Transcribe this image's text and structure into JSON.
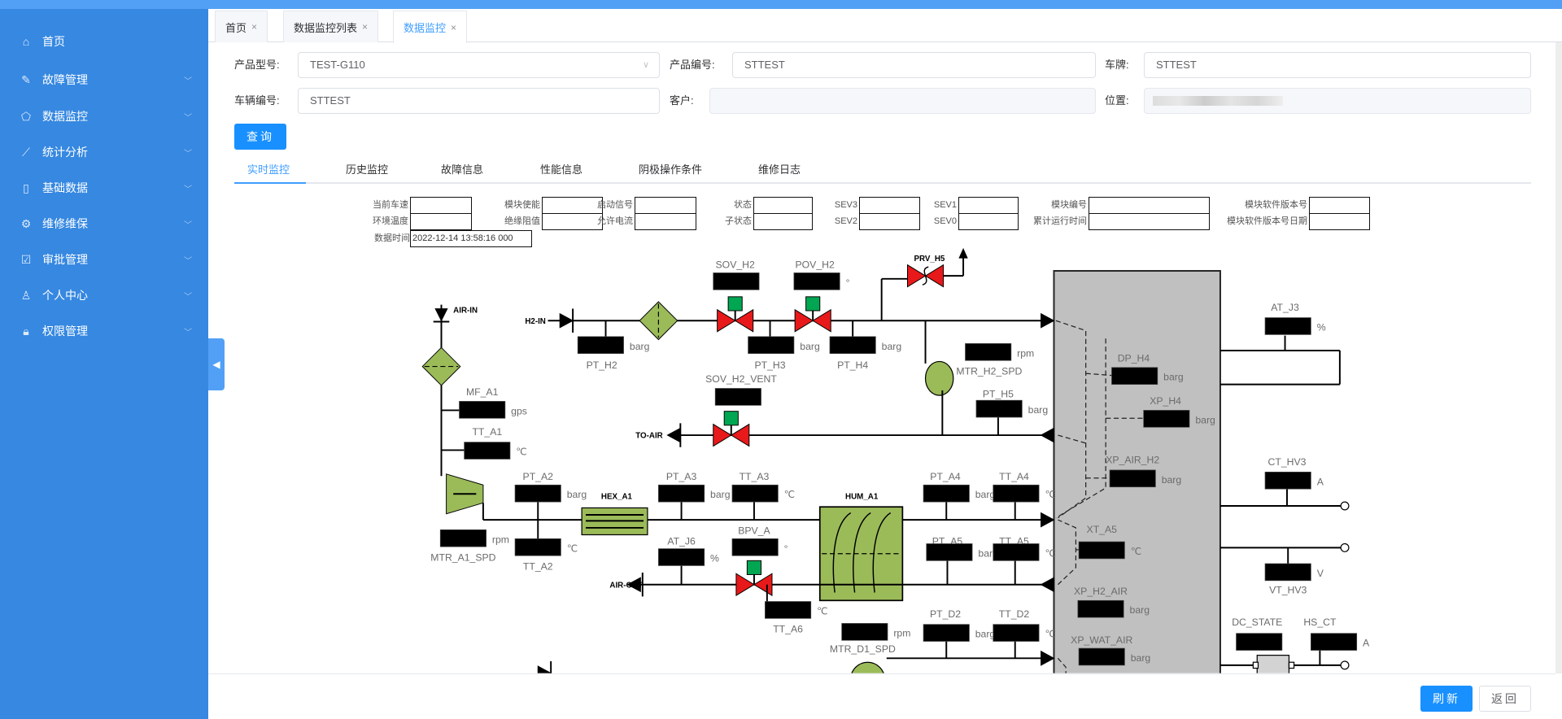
{
  "sidebar": {
    "items": [
      {
        "label": "首页",
        "icon": "home-icon",
        "glyph": "⌂",
        "chevron": false
      },
      {
        "label": "故障管理",
        "icon": "wrench-icon",
        "glyph": "✎",
        "chevron": true
      },
      {
        "label": "数据监控",
        "icon": "monitor-icon",
        "glyph": "⬠",
        "chevron": true
      },
      {
        "label": "统计分析",
        "icon": "line-chart-icon",
        "glyph": "⟋",
        "chevron": true
      },
      {
        "label": "基础数据",
        "icon": "document-icon",
        "glyph": "▯",
        "chevron": true
      },
      {
        "label": "维修维保",
        "icon": "gear-icon",
        "glyph": "⚙",
        "chevron": true
      },
      {
        "label": "审批管理",
        "icon": "checkbox-icon",
        "glyph": "☑",
        "chevron": true
      },
      {
        "label": "个人中心",
        "icon": "user-icon",
        "glyph": "♙",
        "chevron": true
      },
      {
        "label": "权限管理",
        "icon": "lock-icon",
        "glyph": "🔒︎",
        "chevron": true
      }
    ],
    "chevron_glyph": "﹀",
    "collapse_glyph": "◀"
  },
  "tabs": [
    {
      "label": "首页"
    },
    {
      "label": "数据监控列表"
    },
    {
      "label": "数据监控",
      "active": true
    }
  ],
  "tab_close": "×",
  "form": {
    "product_model": {
      "label": "产品型号:",
      "value": "TEST-G110"
    },
    "product_no": {
      "label": "产品编号:",
      "value": "STTEST"
    },
    "plate": {
      "label": "车牌:",
      "value": "STTEST"
    },
    "vehicle_no": {
      "label": "车辆编号:",
      "value": "STTEST"
    },
    "customer": {
      "label": "客户:",
      "value": ""
    },
    "location": {
      "label": "位置:",
      "value": ""
    },
    "query": "查询",
    "select_arrow": "∨"
  },
  "subtabs": [
    "实时监控",
    "历史监控",
    "故障信息",
    "性能信息",
    "阴极操作条件",
    "维修日志"
  ],
  "active_subtab": "实时监控",
  "info": {
    "row1": [
      "当前车速",
      "模块使能",
      "启动信号",
      "状态",
      "SEV3",
      "SEV1",
      "模块编号",
      "模块软件版本号"
    ],
    "row2": [
      "环境温度",
      "绝缘阻值",
      "允许电流",
      "子状态",
      "SEV2",
      "SEV0",
      "累计运行时间",
      "模块软件版本号日期"
    ],
    "data_time_label": "数据时间",
    "data_time_value": "2022-12-14 13:58:16 000"
  },
  "diagram": {
    "streams": {
      "h2_in": "H2-IN",
      "to_air": "TO-AIR",
      "air_in": "AIR-IN",
      "air_out": "AIR-OUT",
      "prv": "PRV_H5",
      "hex": "HEX_A1",
      "hum": "HUM_A1"
    },
    "tags": [
      {
        "id": "PT_H2",
        "unit": "barg"
      },
      {
        "id": "SOV_H2",
        "unit": ""
      },
      {
        "id": "PT_H3",
        "unit": "barg"
      },
      {
        "id": "POV_H2",
        "unit": "°"
      },
      {
        "id": "PT_H4",
        "unit": "barg"
      },
      {
        "id": "MTR_H2_SPD",
        "unit": "rpm"
      },
      {
        "id": "SOV_H2_VENT",
        "unit": ""
      },
      {
        "id": "PT_H5",
        "unit": "barg"
      },
      {
        "id": "MF_A1",
        "unit": "gps"
      },
      {
        "id": "TT_A1",
        "unit": "℃"
      },
      {
        "id": "PT_A2",
        "unit": "barg"
      },
      {
        "id": "TT_A2",
        "unit": "℃"
      },
      {
        "id": "MTR_A1_SPD",
        "unit": "rpm"
      },
      {
        "id": "PT_A3",
        "unit": "barg"
      },
      {
        "id": "TT_A3",
        "unit": "℃"
      },
      {
        "id": "PT_A4",
        "unit": "barg"
      },
      {
        "id": "TT_A4",
        "unit": "℃"
      },
      {
        "id": "AT_J6",
        "unit": "%"
      },
      {
        "id": "BPV_A",
        "unit": "°"
      },
      {
        "id": "TT_A6",
        "unit": "℃"
      },
      {
        "id": "PT_A5",
        "unit": "barg"
      },
      {
        "id": "TT_A5",
        "unit": "℃"
      },
      {
        "id": "PT_D2",
        "unit": "barg"
      },
      {
        "id": "TT_D2",
        "unit": "℃"
      },
      {
        "id": "MTR_D1_SPD",
        "unit": "rpm"
      },
      {
        "id": "DP_H4",
        "unit": "barg"
      },
      {
        "id": "XP_H4",
        "unit": "barg"
      },
      {
        "id": "XP_AIR_H2",
        "unit": "barg"
      },
      {
        "id": "XT_A5",
        "unit": "℃"
      },
      {
        "id": "XP_H2_AIR",
        "unit": "barg"
      },
      {
        "id": "XP_WAT_AIR",
        "unit": "barg"
      },
      {
        "id": "AT_J3",
        "unit": "%"
      },
      {
        "id": "CT_HV3",
        "unit": "A"
      },
      {
        "id": "VT_HV3",
        "unit": "V"
      },
      {
        "id": "DC_STATE",
        "unit": ""
      },
      {
        "id": "HS_CT",
        "unit": "A"
      }
    ],
    "colors": {
      "valve": "#e8191a",
      "actuator": "#00a651",
      "equipment": "#9bbb59",
      "stack": "#c0c0c0"
    }
  },
  "footer": {
    "refresh": "刷新",
    "back": "返回"
  }
}
